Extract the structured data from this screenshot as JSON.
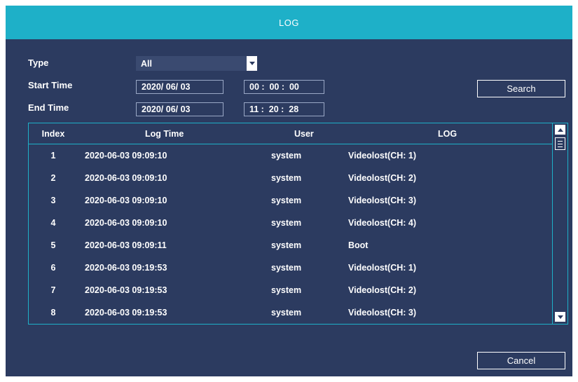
{
  "window": {
    "title": "LOG"
  },
  "filters": {
    "type_label": "Type",
    "type_value": "All",
    "start_label": "Start Time",
    "start_date": "2020/ 06/ 03",
    "start_time": "00 :  00 :  00",
    "end_label": "End Time",
    "end_date": "2020/ 06/ 03",
    "end_time": "11 :  20 :  28",
    "search_label": "Search"
  },
  "table": {
    "headers": {
      "index": "Index",
      "log_time": "Log Time",
      "user": "User",
      "log": "LOG"
    },
    "rows": [
      {
        "index": "1",
        "log_time": "2020-06-03 09:09:10",
        "user": "system",
        "log": "Videolost(CH: 1)"
      },
      {
        "index": "2",
        "log_time": "2020-06-03 09:09:10",
        "user": "system",
        "log": "Videolost(CH: 2)"
      },
      {
        "index": "3",
        "log_time": "2020-06-03 09:09:10",
        "user": "system",
        "log": "Videolost(CH: 3)"
      },
      {
        "index": "4",
        "log_time": "2020-06-03 09:09:10",
        "user": "system",
        "log": "Videolost(CH: 4)"
      },
      {
        "index": "5",
        "log_time": "2020-06-03 09:09:11",
        "user": "system",
        "log": "Boot"
      },
      {
        "index": "6",
        "log_time": "2020-06-03 09:19:53",
        "user": "system",
        "log": "Videolost(CH: 1)"
      },
      {
        "index": "7",
        "log_time": "2020-06-03 09:19:53",
        "user": "system",
        "log": "Videolost(CH: 2)"
      },
      {
        "index": "8",
        "log_time": "2020-06-03 09:19:53",
        "user": "system",
        "log": "Videolost(CH: 3)"
      }
    ]
  },
  "footer": {
    "cancel_label": "Cancel"
  },
  "colors": {
    "titlebar": "#1eb0c8",
    "background": "#2c3b60",
    "border_accent": "#1eb0c8"
  },
  "icons": {
    "dropdown": "chevron-down-icon",
    "scroll_up": "scroll-up-icon",
    "scroll_down": "scroll-down-icon"
  }
}
